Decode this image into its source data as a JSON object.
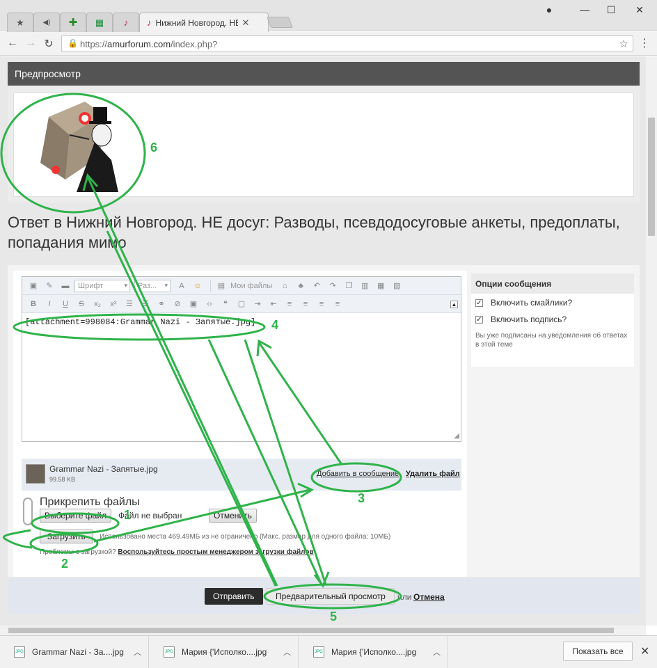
{
  "browser": {
    "tabs": [
      {
        "icon": "star-icon",
        "glyph": "★"
      },
      {
        "icon": "speaker-icon",
        "glyph": "◀"
      },
      {
        "icon": "plus-icon",
        "glyph": "✚"
      },
      {
        "icon": "sheet-icon",
        "glyph": "▦"
      },
      {
        "icon": "forum-icon",
        "glyph": "♪"
      },
      {
        "icon": "forum-icon",
        "glyph": "♪",
        "title": "Нижний Новгород. НЕ д"
      }
    ],
    "url_scheme": "https://",
    "url_host": "amurforum.com",
    "url_path": "/index.php?"
  },
  "preview": {
    "header": "Предпросмотр"
  },
  "page": {
    "title": "Ответ в Нижний Новгород. НЕ досуг: Разводы, псевдодосуговые анкеты, предоплаты, попадания мимо"
  },
  "editor": {
    "font_select": "Шрифт",
    "size_select": "Раз...",
    "my_files": "Мои файлы",
    "content": "[attachment=998084:Grammar Nazi - Запятые.jpg]"
  },
  "attachment": {
    "name": "Grammar Nazi - Запятые.jpg",
    "size": "99.58 KB",
    "add_link": "Добавить в сообщение",
    "delete_link": "Удалить файл"
  },
  "upload": {
    "title": "Прикрепить файлы",
    "choose_button": "Выберите файл",
    "no_file": "Файл не выбран",
    "cancel_button": "Отменить",
    "upload_button": "Загрузить",
    "usage": "Использовано места 469.49МБ из не ограничено (Макс. размер для одного файла: 10МБ)",
    "problems": "Проблемы с загрузкой?",
    "manager_link": "Воспользуйтесь простым менеджером загрузки файлов"
  },
  "options": {
    "header": "Опции сообщения",
    "smilies": "Включить смайлики?",
    "smilies_checked": true,
    "signature": "Включить подпись?",
    "signature_checked": true,
    "note": "Вы уже подписаны на уведомления об ответах в этой теме"
  },
  "submit": {
    "send": "Отправить",
    "preview": "Предварительный просмотр",
    "or": "или",
    "cancel": "Отмена"
  },
  "downloads": {
    "items": [
      {
        "name": "Grammar Nazi - За....jpg"
      },
      {
        "name": "Мария {'Исполко....jpg"
      },
      {
        "name": "Мария {'Исполко....jpg"
      }
    ],
    "show_all": "Показать все"
  },
  "annotations": {
    "color": "#2fb34a",
    "numbers": [
      "1",
      "2",
      "3",
      "4",
      "5",
      "6"
    ]
  }
}
